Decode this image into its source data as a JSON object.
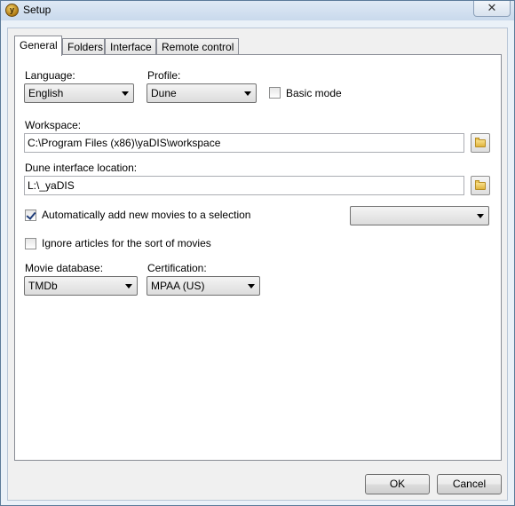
{
  "window": {
    "title": "Setup",
    "close_glyph": "✕",
    "icon_letter": "y"
  },
  "tabs": [
    {
      "label": "General",
      "active": true
    },
    {
      "label": "Folders",
      "active": false
    },
    {
      "label": "Interface",
      "active": false
    },
    {
      "label": "Remote control",
      "active": false
    }
  ],
  "general": {
    "language_label": "Language:",
    "language_value": "English",
    "profile_label": "Profile:",
    "profile_value": "Dune",
    "basic_mode_label": "Basic mode",
    "basic_mode_checked": false,
    "workspace_label": "Workspace:",
    "workspace_value": "C:\\Program Files (x86)\\yaDIS\\workspace",
    "dune_location_label": "Dune interface location:",
    "dune_location_value": "L:\\_yaDIS",
    "auto_add_label": "Automatically add new movies to a selection",
    "auto_add_checked": true,
    "selection_value": "",
    "ignore_articles_label": "Ignore articles for the sort of movies",
    "ignore_articles_checked": false,
    "movie_db_label": "Movie database:",
    "movie_db_value": "TMDb",
    "certification_label": "Certification:",
    "certification_value": "MPAA (US)"
  },
  "buttons": {
    "ok": "OK",
    "cancel": "Cancel"
  }
}
